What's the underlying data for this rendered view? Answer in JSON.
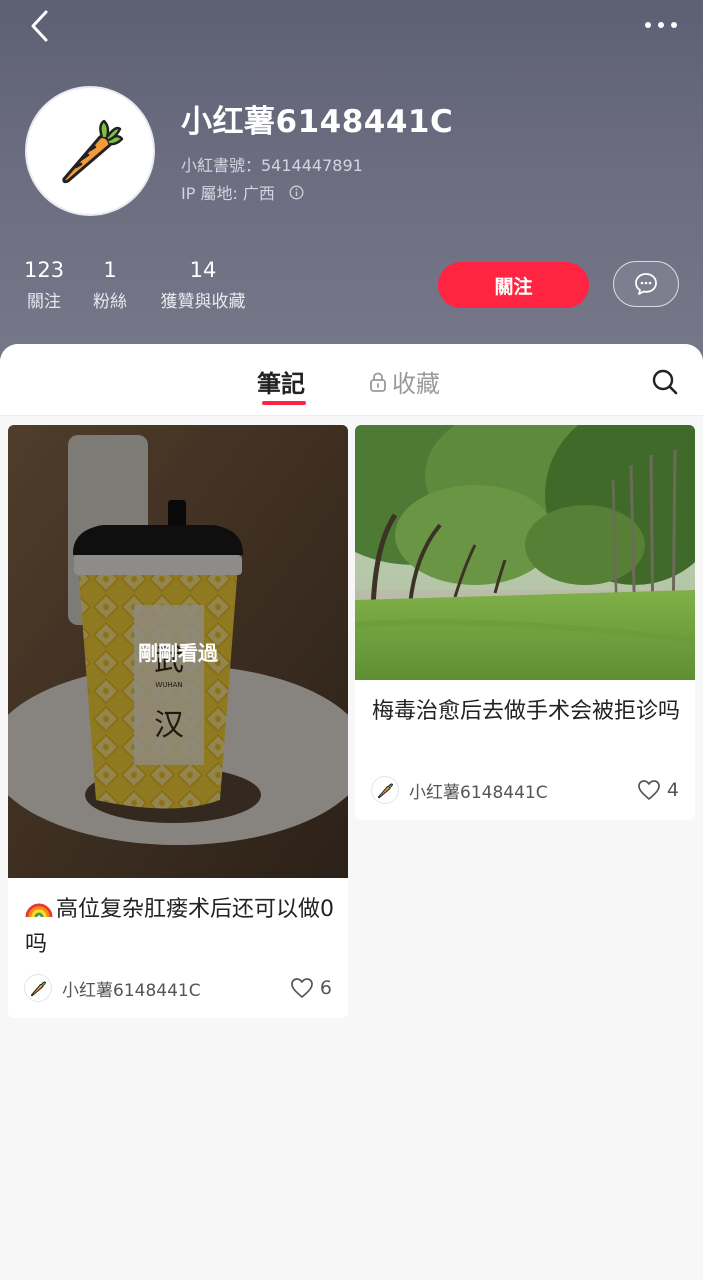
{
  "header": {
    "username": "小红薯6148441C",
    "account_id": "小紅書號：5414447891",
    "ip_location": "IP 屬地: 广西",
    "icons": {
      "back": "chevron-left-icon",
      "more": "more-horizontal-icon",
      "info": "info-icon",
      "avatar": "carrot-icon",
      "message": "chat-bubble-icon"
    }
  },
  "stats": [
    {
      "value": "123",
      "label": "關注"
    },
    {
      "value": "1",
      "label": "粉絲"
    },
    {
      "value": "14",
      "label": "獲贊與收藏"
    }
  ],
  "actions": {
    "follow_label": "關注"
  },
  "tabs": [
    {
      "label": "筆記",
      "active": true
    },
    {
      "label": "收藏",
      "active": false,
      "icon": "lock-icon"
    }
  ],
  "notes": [
    {
      "title": "高位复杂肛瘘术后还可以做0吗",
      "title_emoji": "rainbow",
      "overlay_label": "剛剛看過",
      "author": "小红薯6148441C",
      "likes": "6",
      "cup_text": {
        "top": "武",
        "mid": "汉",
        "roman": "WUHAN"
      }
    },
    {
      "title": "梅毒治愈后去做手术会被拒诊吗",
      "author": "小红薯6148441C",
      "likes": "4"
    }
  ],
  "colors": {
    "accent": "#ff2442",
    "header_bg": "#676879"
  }
}
